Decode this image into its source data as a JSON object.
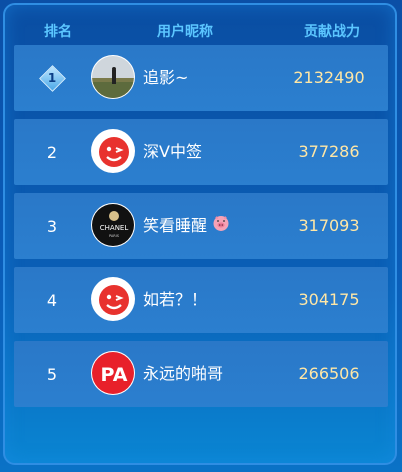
{
  "header": {
    "rank_label": "排名",
    "name_label": "用户昵称",
    "score_label": "贡献战力"
  },
  "rows": [
    {
      "rank": "1",
      "name": "追影~",
      "score": "2132490",
      "avatar": "landscape-photo-avatar"
    },
    {
      "rank": "2",
      "name": "深V中签",
      "score": "377286",
      "avatar": "red-smile-logo-avatar"
    },
    {
      "rank": "3",
      "name": "笑看睡醒",
      "score": "317093",
      "avatar": "chanel-logo-avatar",
      "emoji": "pig-face-emoji"
    },
    {
      "rank": "4",
      "name": "如若？！",
      "score": "304175",
      "avatar": "red-smile-logo-avatar"
    },
    {
      "rank": "5",
      "name": "永远的啪哥",
      "score": "266506",
      "avatar": "pa-logo-avatar"
    }
  ],
  "colors": {
    "background": "#0b4fa6",
    "row": "#2a78c8",
    "header_text": "#5bc6ff",
    "score_text": "#ffe7a6"
  }
}
